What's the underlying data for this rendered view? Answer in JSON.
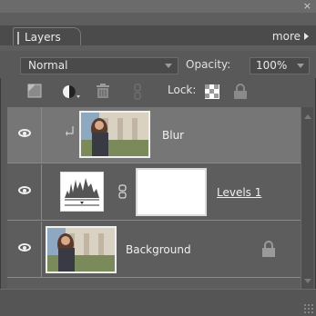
{
  "panel": {
    "tab_label": "Layers",
    "more_label": "more",
    "blend_mode": "Normal",
    "opacity_label": "Opacity:",
    "opacity_value": "100%",
    "lock_label": "Lock:"
  },
  "layers": [
    {
      "name": "Blur",
      "selected": true,
      "visible": true,
      "type": "image"
    },
    {
      "name": "Levels 1",
      "selected": false,
      "visible": true,
      "type": "adjustment"
    },
    {
      "name": "Background",
      "selected": false,
      "visible": true,
      "type": "image",
      "locked": true
    }
  ],
  "colors": {
    "panel_bg": "#595959",
    "selected_row": "#767676",
    "text": "#f0f0f0"
  }
}
